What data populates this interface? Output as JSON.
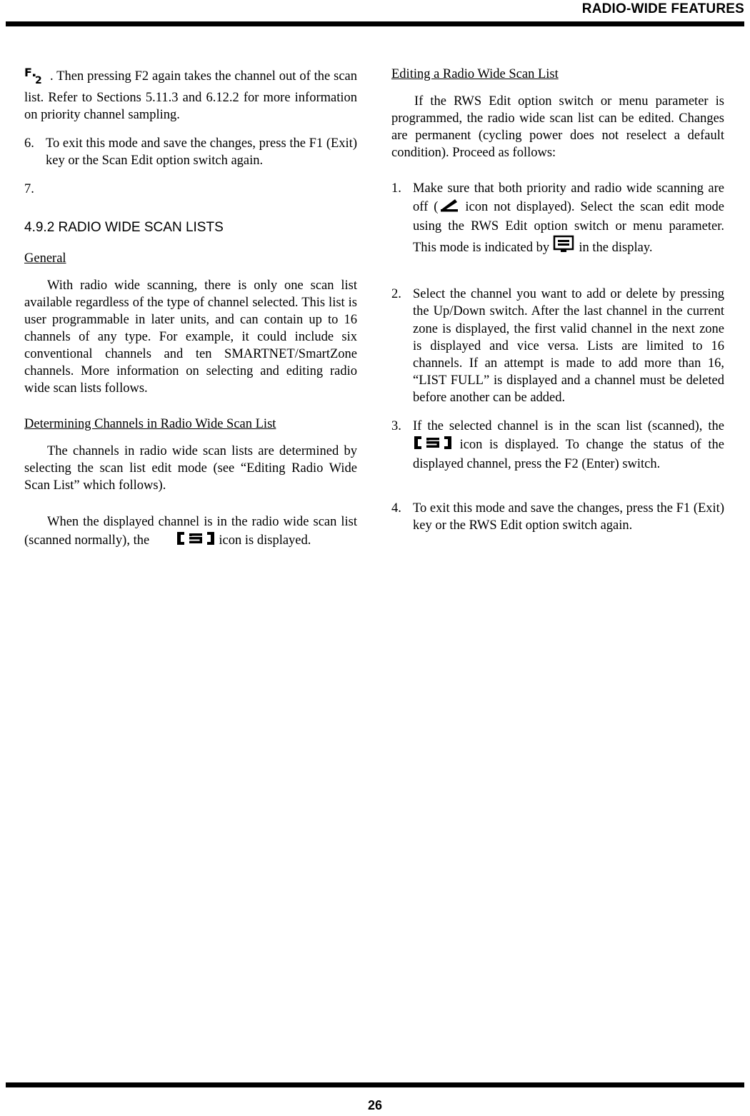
{
  "header": {
    "title": "RADIO-WIDE FEATURES"
  },
  "footer": {
    "page_number": "26"
  },
  "left_column": {
    "f2_icon_label": "F2",
    "para_f2_continued": ". Then pressing F2 again takes the channel out of the scan list. Refer to Sections 5.11.3 and 6.12.2 for more information on priority channel sampling.",
    "item6_num": "6.",
    "item6_text": "To exit this mode and save the changes, press the F1 (Exit) key or the Scan Edit option switch again.",
    "item7_num": "7.",
    "item7_text": "",
    "section_number_title": "4.9.2  RADIO WIDE SCAN LISTS",
    "general_heading": "General",
    "general_para": "With radio wide scanning, there is only one scan list available regardless of the type of channel selected. This list is user programmable in later units, and can contain up to 16 channels of any type. For example, it could include six conventional channels and ten SMARTNET/SmartZone channels. More information on selecting and editing radio wide scan lists follows.",
    "determining_heading": "Determining Channels in Radio Wide Scan List",
    "determining_para": "The channels in radio wide scan lists are determined by selecting the scan list edit mode (see “Editing Radio Wide Scan List” which follows).",
    "displayed_para_part1": "When the displayed channel is in the radio wide scan list (scanned normally), the ",
    "displayed_para_part2": " icon is displayed."
  },
  "right_column": {
    "editing_heading": "Editing a Radio Wide Scan List",
    "editing_para": "If the RWS Edit option switch or menu parameter is programmed, the radio wide scan list can be edited. Changes are permanent (cycling power does not reselect a default condition). Proceed as follows:",
    "item1_num": "1.",
    "item1_text_a": "Make sure that both priority and radio wide scanning are off (",
    "item1_text_b": " icon not displayed). Select the scan edit mode using the RWS Edit option switch or menu parameter. This mode is indicated by ",
    "item1_text_c": " in the display.",
    "item2_num": "2.",
    "item2_text": "Select the channel you want to add or delete by pressing the Up/Down switch. After the last channel in the current zone is displayed, the first valid channel in the next zone is displayed and vice versa. Lists are limited to 16 channels. If an attempt is made to add more than 16, “LIST FULL” is displayed and a channel must be deleted before another can be added.",
    "item3_num": "3.",
    "item3_text_a": "If the selected channel is in the scan list (scanned), the ",
    "item3_text_b": " icon is displayed. To change the status of the displayed channel, press the F2 (Enter) switch.",
    "item4_num": "4.",
    "item4_text": "To exit this mode and save the changes, press the F1 (Exit) key or the RWS Edit option switch again."
  },
  "icons": {
    "scan_bracket_icon": "scan-list-bracket-icon",
    "scan_diagonal_icon": "scan-diagonal-icon",
    "edit_mode_icon": "scan-edit-mode-icon",
    "f2_key_icon": "f2-key-icon"
  }
}
